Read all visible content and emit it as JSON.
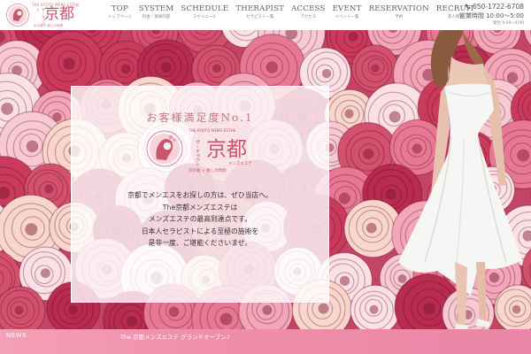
{
  "logo": {
    "small_text": "THE KYOTO MENS ESTHE",
    "ruby": "ザ・キョウト",
    "kanji": "京都",
    "sub": "京の雅 × 癒しの時間"
  },
  "nav": [
    {
      "en": "TOP",
      "jp": "トップページ"
    },
    {
      "en": "SYSTEM",
      "jp": "料金・施術内容"
    },
    {
      "en": "SCHEDULE",
      "jp": "スケジュール"
    },
    {
      "en": "THERAPIST",
      "jp": "セラピスト一覧"
    },
    {
      "en": "ACCESS",
      "jp": "アクセス"
    },
    {
      "en": "EVENT",
      "jp": "イベント一覧"
    },
    {
      "en": "RESERVATION",
      "jp": "予約"
    },
    {
      "en": "RECRUIT",
      "jp": "求人情報"
    }
  ],
  "contact": {
    "phone": "050-1722-6708",
    "hours": "営業時間 10:00～5:00",
    "reception": "受付 9:00～4:00"
  },
  "panel": {
    "tagline": "お客様満足度No.1",
    "logo_small": "THE KYOTO MENS ESTHE",
    "logo_ruby": "ザ・キョウト",
    "logo_kanji": "京都",
    "logo_kana": "メンズエステ",
    "logo_sub": "京の雅 × 癒しの時間",
    "intro": [
      "京都でメンエスをお探しの方は、ぜひ当店へ。",
      "The京都メンズエステは",
      "メンズエステの最高到達点です。",
      "日本人セラピストによる至極の施術を",
      "是非一度、ご堪能くださいませ。"
    ]
  },
  "news": {
    "label": "NEWS",
    "headline": "The 京都メンズエステ グランドオープン♪"
  },
  "colors": {
    "accent": "#c8566c",
    "news_bar": "#ef8fab",
    "nav_text": "#6a5b5f"
  },
  "icons": {
    "phone": "phone-icon",
    "emblem": "geisha-emblem-icon"
  }
}
